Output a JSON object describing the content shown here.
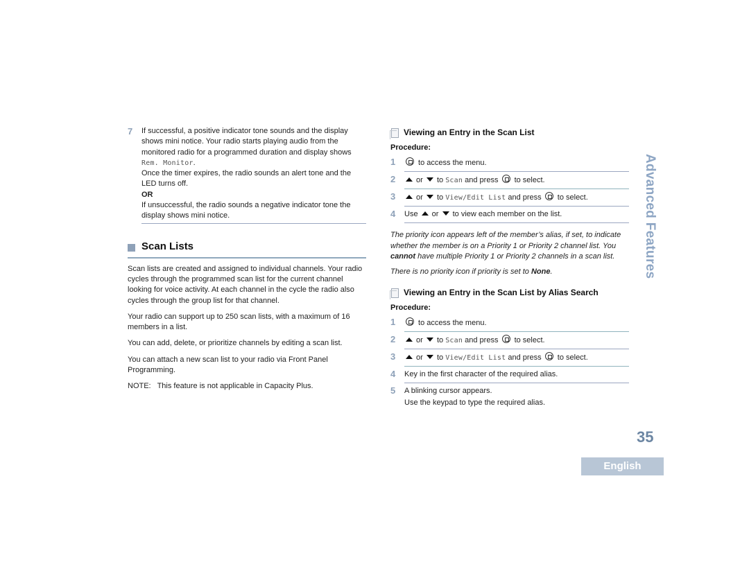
{
  "left": {
    "step7": {
      "number": "7",
      "text_before_mono": "If successful, a positive indicator tone sounds and the display shows mini notice. Your radio starts playing audio from the monitored radio for a programmed duration and display shows ",
      "mono": "Rem. Monitor",
      "text_after_mono": ".",
      "line2": "Once the timer expires, the radio sounds an alert tone and the LED turns off.",
      "or": "OR",
      "line3": "If unsuccessful, the radio sounds a negative indicator tone the display shows mini notice."
    },
    "section": {
      "title": "Scan Lists",
      "paragraphs": [
        "Scan lists are created and assigned to individual channels. Your radio cycles through the programmed scan list for the current channel looking for voice activity. At each channel in the cycle the radio also cycles through the group list for that channel.",
        "Your radio can support up to 250 scan lists, with a maximum of 16 members in a list.",
        "You can add, delete, or prioritize channels by editing a scan list.",
        "You can attach a new scan list to your radio via Front Panel Programming.",
        "NOTE:   This feature is not applicable in Capacity Plus."
      ]
    }
  },
  "right": {
    "sub1": {
      "title": "Viewing an Entry in the Scan List",
      "procedure": "Procedure:",
      "steps": [
        {
          "n": "1",
          "a": " to access the menu."
        },
        {
          "n": "2",
          "or": " or ",
          "to": " to ",
          "mono": "Scan",
          "press": " and press ",
          "end": " to select."
        },
        {
          "n": "3",
          "or": " or ",
          "to": " to ",
          "mono": "View/Edit List",
          "press": " and press ",
          "end": " to select."
        },
        {
          "n": "4",
          "use": "Use ",
          "or": " or ",
          "end": " to view each member on the list."
        }
      ],
      "note1_a": "The priority icon appears left of the member’s alias, if set, to indicate whether the member is on a Priority 1 or Priority 2 channel list. You ",
      "note1_b": "cannot",
      "note1_c": " have multiple Priority 1 or Priority 2 channels in a scan list.",
      "note2_a": "There is no priority icon if priority is set to ",
      "note2_b": "None",
      "note2_c": "."
    },
    "sub2": {
      "title": "Viewing an Entry in the Scan List by Alias Search",
      "procedure": "Procedure:",
      "steps": [
        {
          "n": "1",
          "a": " to access the menu."
        },
        {
          "n": "2",
          "or": " or ",
          "to": " to ",
          "mono": "Scan",
          "press": " and press ",
          "end": " to select."
        },
        {
          "n": "3",
          "or": " or ",
          "to": " to ",
          "mono": "View/Edit List",
          "press": " and press ",
          "end": " to select."
        },
        {
          "n": "4",
          "a": "Key in the first character of the required alias."
        },
        {
          "n": "5",
          "a": "A blinking cursor appears.",
          "b": "Use the keypad to type the required alias."
        }
      ]
    }
  },
  "side": {
    "chapter": "Advanced Features",
    "page_number": "35",
    "language": "English"
  }
}
